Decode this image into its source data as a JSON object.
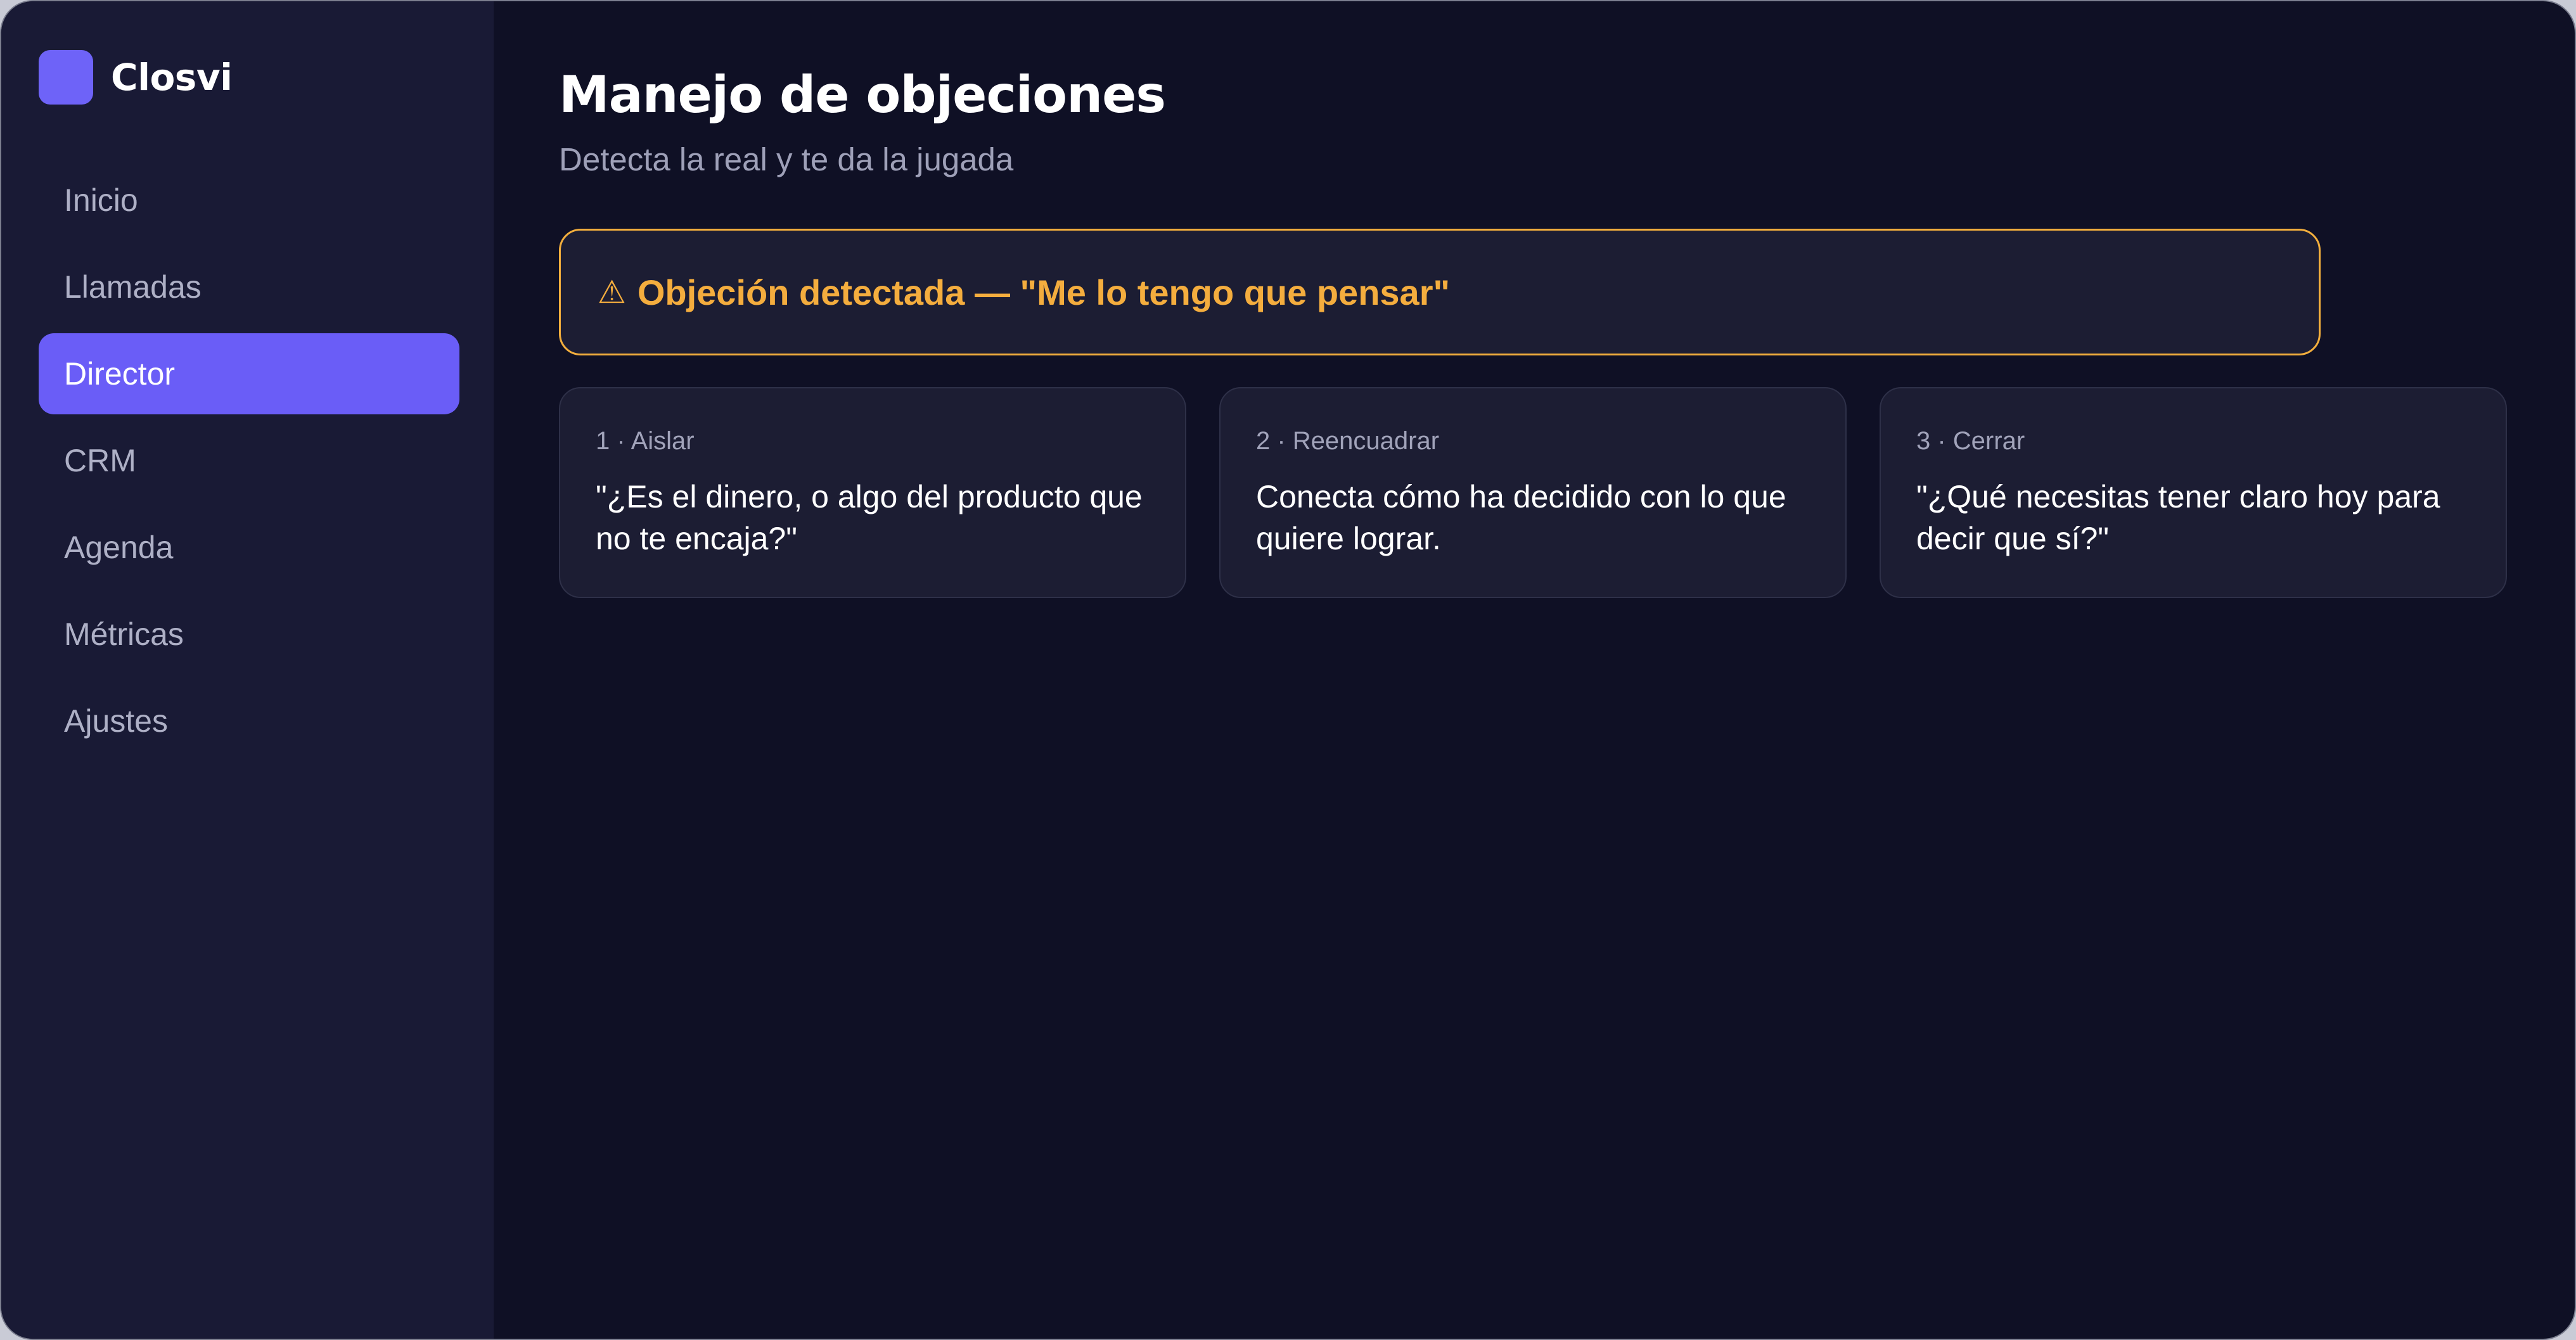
{
  "app": {
    "name": "Closvi"
  },
  "sidebar": {
    "items": [
      {
        "label": "Inicio",
        "active": false
      },
      {
        "label": "Llamadas",
        "active": false
      },
      {
        "label": "Director",
        "active": true
      },
      {
        "label": "CRM",
        "active": false
      },
      {
        "label": "Agenda",
        "active": false
      },
      {
        "label": "Métricas",
        "active": false
      },
      {
        "label": "Ajustes",
        "active": false
      }
    ]
  },
  "main": {
    "title": "Manejo de objeciones",
    "subtitle": "Detecta la real y te da la jugada",
    "alert": {
      "icon": "warning-icon",
      "icon_glyph": "⚠",
      "text": "Objeción detectada — \"Me lo tengo que pensar\""
    },
    "cards": [
      {
        "label": "1 · Aislar",
        "text": "\"¿Es el dinero, o algo del producto que no te encaja?\""
      },
      {
        "label": "2 · Reencuadrar",
        "text": "Conecta cómo ha decidido con lo que quiere lograr."
      },
      {
        "label": "3 · Cerrar",
        "text": "\"¿Qué necesitas tener claro hoy para decir que sí?\""
      }
    ]
  },
  "colors": {
    "accent": "#6a5df7",
    "warning": "#f4ad3e",
    "background": "#0f1025",
    "sidebar": "#191a35"
  }
}
